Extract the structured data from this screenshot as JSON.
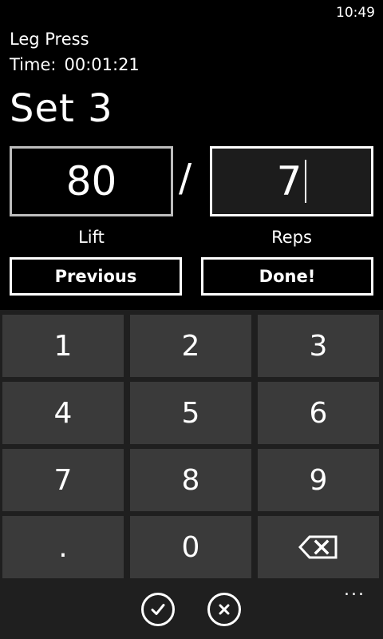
{
  "status_bar": {
    "time": "10:49"
  },
  "header": {
    "exercise": "Leg Press",
    "time_label": "Time:",
    "time_value": "00:01:21",
    "set_title": "Set 3"
  },
  "entry": {
    "lift_value": "80",
    "separator": "/",
    "reps_value": "7",
    "lift_label": "Lift",
    "reps_label": "Reps"
  },
  "actions": {
    "previous_label": "Previous",
    "done_label": "Done!"
  },
  "keypad": {
    "keys": [
      "1",
      "2",
      "3",
      "4",
      "5",
      "6",
      "7",
      "8",
      "9",
      ".",
      "0"
    ],
    "backspace_icon": "backspace-icon"
  },
  "app_bar": {
    "confirm_icon": "checkmark-icon",
    "cancel_icon": "close-icon",
    "more_label": "..."
  }
}
